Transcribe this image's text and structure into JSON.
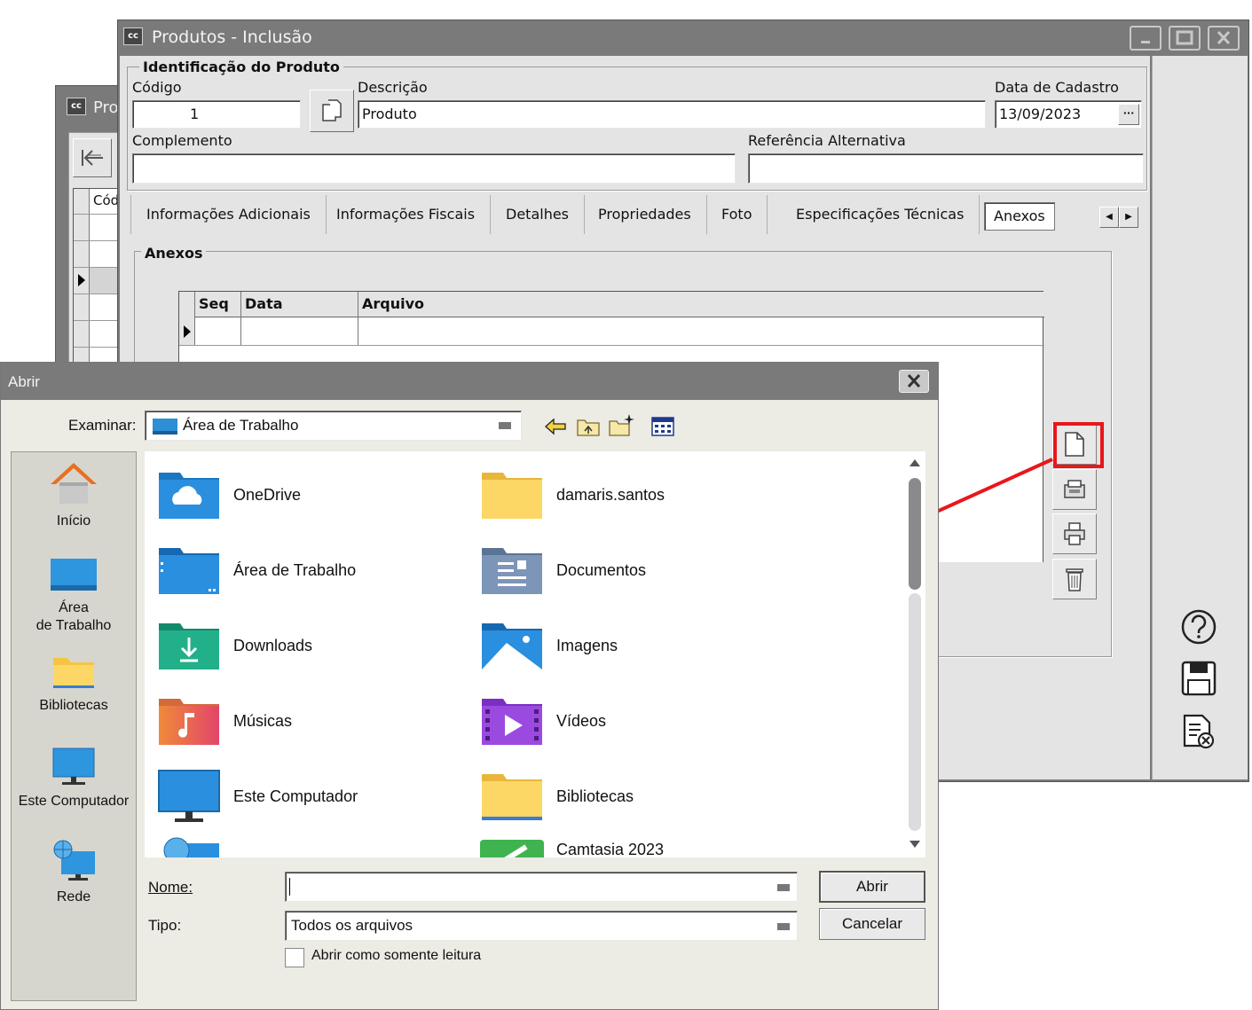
{
  "bg_window": {
    "cc": "cc",
    "title_partial": "Pro",
    "grid_header_partial": "Cód"
  },
  "main_window": {
    "cc": "cc",
    "title": "Produtos - Inclusão",
    "group_title": "Identificação do Produto",
    "codigo_label": "Código",
    "codigo_value": "1",
    "descricao_label": "Descrição",
    "descricao_value": "Produto",
    "data_cadastro_label": "Data de Cadastro",
    "data_cadastro_value": "13/09/2023",
    "ellipsis": "···",
    "complemento_label": "Complemento",
    "complemento_value": "",
    "ref_alt_label": "Referência Alternativa",
    "ref_alt_value": "",
    "tabs": [
      "Informações Adicionais",
      "Informações Fiscais",
      "Detalhes",
      "Propriedades",
      "Foto",
      "Especificações Técnicas",
      "Anexos"
    ],
    "anexos_group_title": "Anexos",
    "grid_headers": {
      "seq": "Seq",
      "data": "Data",
      "arquivo": "Arquivo"
    }
  },
  "dialog": {
    "title": "Abrir",
    "examinar_label": "Examinar:",
    "examinar_value": "Área de Trabalho",
    "places": [
      {
        "label": "Início",
        "icon": "home-icon"
      },
      {
        "label": "Área\nde Trabalho",
        "icon": "desktop-icon"
      },
      {
        "label": "Bibliotecas",
        "icon": "libraries-icon"
      },
      {
        "label": "Este Computador",
        "icon": "computer-icon"
      },
      {
        "label": "Rede",
        "icon": "network-icon"
      }
    ],
    "files": [
      {
        "name": "OneDrive",
        "icon": "onedrive-folder-icon"
      },
      {
        "name": "damaris.santos",
        "icon": "user-folder-icon"
      },
      {
        "name": "Área de Trabalho",
        "icon": "desktop-folder-icon"
      },
      {
        "name": "Documentos",
        "icon": "documents-folder-icon"
      },
      {
        "name": "Downloads",
        "icon": "downloads-folder-icon"
      },
      {
        "name": "Imagens",
        "icon": "pictures-folder-icon"
      },
      {
        "name": "Músicas",
        "icon": "music-folder-icon"
      },
      {
        "name": "Vídeos",
        "icon": "videos-folder-icon"
      },
      {
        "name": "Este Computador",
        "icon": "computer-icon"
      },
      {
        "name": "Bibliotecas",
        "icon": "libraries-folder-icon"
      },
      {
        "name": "",
        "icon": "network-icon"
      },
      {
        "name": "Camtasia 2023",
        "icon": "camtasia-icon"
      }
    ],
    "nome_label": "Nome:",
    "nome_value": "",
    "tipo_label": "Tipo:",
    "tipo_value": "Todos os arquivos",
    "readonly_label": "Abrir como somente leitura",
    "open_button": "Abrir",
    "cancel_button": "Cancelar"
  },
  "colors": {
    "highlight": "#e8171b",
    "titlebar": "#7a7a7a",
    "face": "#e4e4e4",
    "folder_yellow": "#f5c542"
  }
}
